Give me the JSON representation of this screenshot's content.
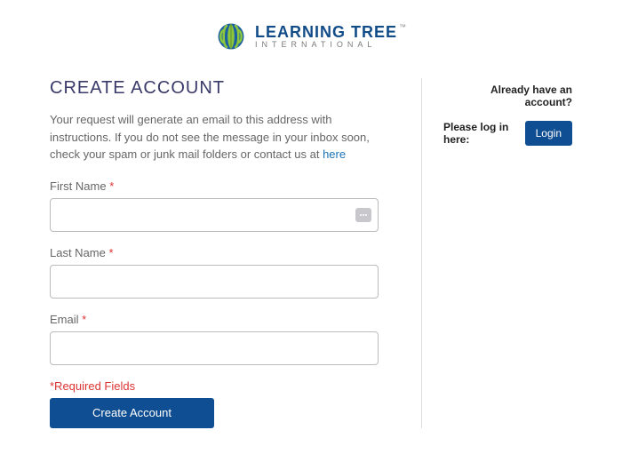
{
  "brand": {
    "title": "LEARNING TREE",
    "subtitle": "INTERNATIONAL",
    "tm": "™"
  },
  "page": {
    "title": "CREATE ACCOUNT",
    "instructions_pre": "Your request will generate an email to this address with instructions. If you do not see the message in your inbox soon, check your spam or junk mail folders or contact us at ",
    "instructions_link": "here"
  },
  "form": {
    "first_name": {
      "label": "First Name",
      "value": ""
    },
    "last_name": {
      "label": "Last Name",
      "value": ""
    },
    "email": {
      "label": "Email",
      "value": ""
    },
    "required_marker": "*",
    "required_note": "*Required Fields",
    "submit_label": "Create Account"
  },
  "aside": {
    "heading": "Already have an account?",
    "login_label": "Please log in here:",
    "login_button": "Login"
  },
  "colors": {
    "brand_blue": "#0f4e92",
    "brand_green": "#6bb33f",
    "required_red": "#d33"
  }
}
